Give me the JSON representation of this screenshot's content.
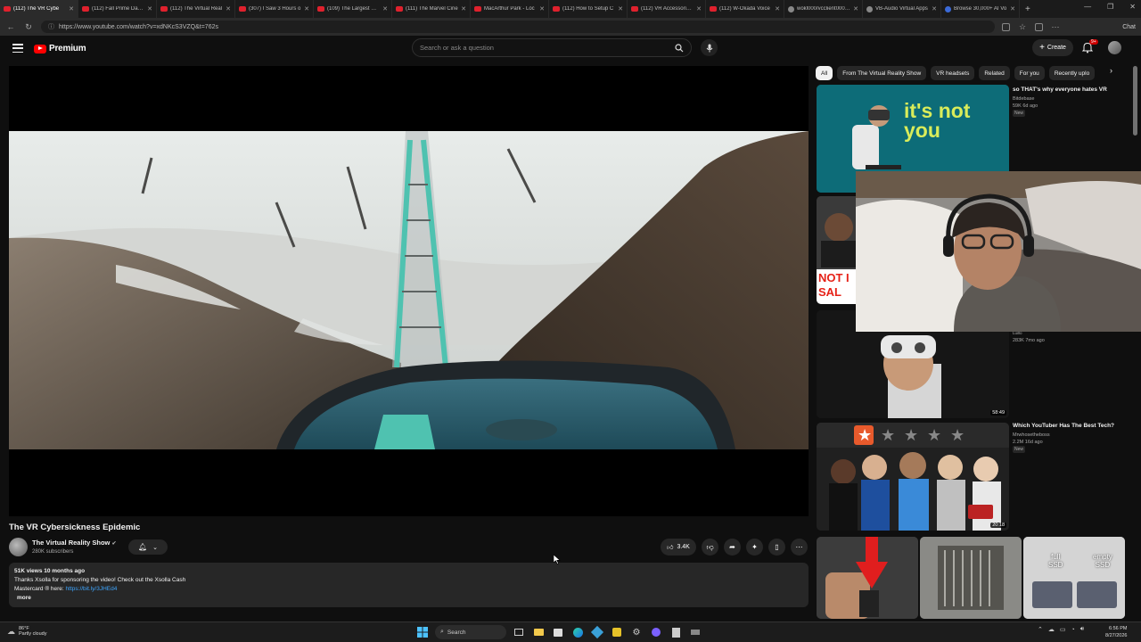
{
  "browser": {
    "tabs": [
      {
        "title": "(112) The VR Cybe",
        "active": true,
        "favicon": "youtube"
      },
      {
        "title": "(112) Fall Prime Day v",
        "active": false,
        "favicon": "youtube"
      },
      {
        "title": "(112) The Virtual Real",
        "active": false,
        "favicon": "youtube"
      },
      {
        "title": "(307) I Saw 3 Hours o",
        "active": false,
        "favicon": "youtube"
      },
      {
        "title": "(109) The Largest Econ",
        "active": false,
        "favicon": "youtube"
      },
      {
        "title": "(111) The Marvel Cine",
        "active": false,
        "favicon": "youtube"
      },
      {
        "title": "MacArthur Park - Loc",
        "active": false,
        "favicon": "youtube"
      },
      {
        "title": "(112) How to Setup C",
        "active": false,
        "favicon": "youtube"
      },
      {
        "title": "(112) VR Accessories f",
        "active": false,
        "favicon": "youtube"
      },
      {
        "title": "(112) W-Okada Voice",
        "active": false,
        "favicon": "youtube"
      },
      {
        "title": "wokl000/vcclient000 at",
        "active": false,
        "favicon": "gray"
      },
      {
        "title": "VB-Audio Virtual Apps",
        "active": false,
        "favicon": "gray"
      },
      {
        "title": "Browse 30,000+ AI Vo",
        "active": false,
        "favicon": "blue"
      }
    ],
    "url": "https://www.youtube.com/watch?v=xdNKcS3VZQ&t=762s",
    "chat_label": "Chat"
  },
  "header": {
    "logo_text": "Premium",
    "search_placeholder": "Search or ask a question",
    "create_label": "Create",
    "notification_count": "9+"
  },
  "video": {
    "title": "The VR Cybersickness Epidemic",
    "channel_name": "The Virtual Reality Show",
    "channel_subs": "280K subscribers",
    "like_count": "3.4K",
    "views_line": "51K views  10 months ago",
    "desc_line1": "Thanks Xsolla for sponsoring the video! Check out the Xsolla Cash",
    "desc_line2_prefix": "Mastercard ® here: ",
    "desc_link": "https://bit.ly/3JHEd4",
    "more_label": "more"
  },
  "chips": [
    "All",
    "From The Virtual Reality Show",
    "VR headsets",
    "Related",
    "For you",
    "Recently uplo"
  ],
  "recommendations": [
    {
      "title": "so THAT's why everyone hates VR",
      "channel": "Bitdebase",
      "views": "59K  6d ago",
      "badge": "New",
      "thumb_text_1": "it's not",
      "thumb_text_2": "you"
    },
    {
      "title": "",
      "channel": "",
      "views": "",
      "thumb_text_1": "NOT I",
      "thumb_text_2": "SAL"
    },
    {
      "title": "",
      "channel": "",
      "views": "283K  7mo ago",
      "duration": "58:49",
      "label_partial": "Luillo"
    },
    {
      "title": "Which YouTuber Has The Best Tech?",
      "channel": "Mrwhosetheboss",
      "views": "2.2M  16d ago",
      "badge": "New",
      "duration": "20:18"
    }
  ],
  "shorts": [
    {
      "text": ""
    },
    {
      "text": ""
    },
    {
      "text_1": "full",
      "text_2": "SSD",
      "text_3": "empty",
      "text_4": "SSD"
    }
  ],
  "taskbar": {
    "weather_temp": "86°F",
    "weather_desc": "Partly cloudy",
    "search_label": "Search",
    "time": "6:56 PM",
    "date": "8/27/2026"
  },
  "colors": {
    "background": "#0f0f0f",
    "surface": "#272727",
    "accent_red": "#ff0000",
    "link": "#3ea6ff"
  }
}
